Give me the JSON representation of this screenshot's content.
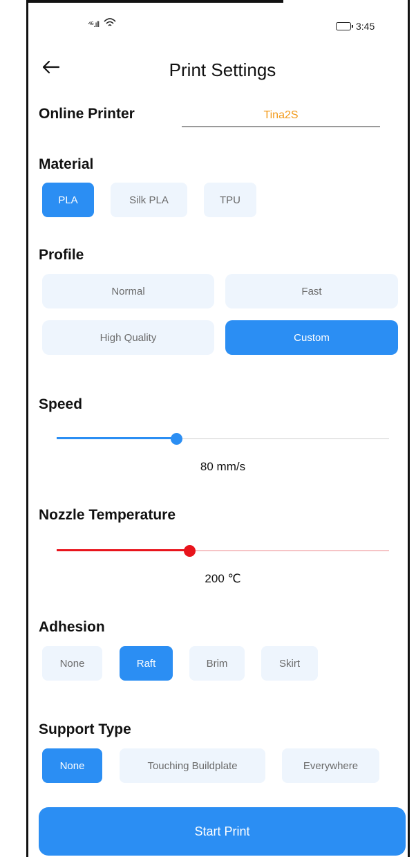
{
  "status_bar": {
    "signal_text": "⁴⁶.ıll",
    "time": "3:45"
  },
  "header": {
    "title": "Print Settings"
  },
  "printer": {
    "label": "Online Printer",
    "value": "Tina2S"
  },
  "material": {
    "title": "Material",
    "options": [
      "PLA",
      "Silk PLA",
      "TPU"
    ],
    "selected": "PLA"
  },
  "profile": {
    "title": "Profile",
    "options": [
      "Normal",
      "Fast",
      "High Quality",
      "Custom"
    ],
    "selected": "Custom"
  },
  "speed": {
    "title": "Speed",
    "value_text": "80 mm/s",
    "level": 0.36,
    "color": "#2b8ef3",
    "track_color": "#e6e6e6"
  },
  "nozzle": {
    "title": "Nozzle Temperature",
    "value_text": "200 ℃",
    "level": 0.4,
    "color": "#e8141c",
    "track_color": "#f6c4c6"
  },
  "adhesion": {
    "title": "Adhesion",
    "options": [
      "None",
      "Raft",
      "Brim",
      "Skirt"
    ],
    "selected": "Raft"
  },
  "support": {
    "title": "Support Type",
    "options": [
      "None",
      "Touching Buildplate",
      "Everywhere"
    ],
    "selected": "None"
  },
  "actions": {
    "start_label": "Start Print"
  },
  "colors": {
    "accent": "#2b8ef3",
    "printer_value": "#f29a1a",
    "chip_bg": "#eef5fd"
  }
}
